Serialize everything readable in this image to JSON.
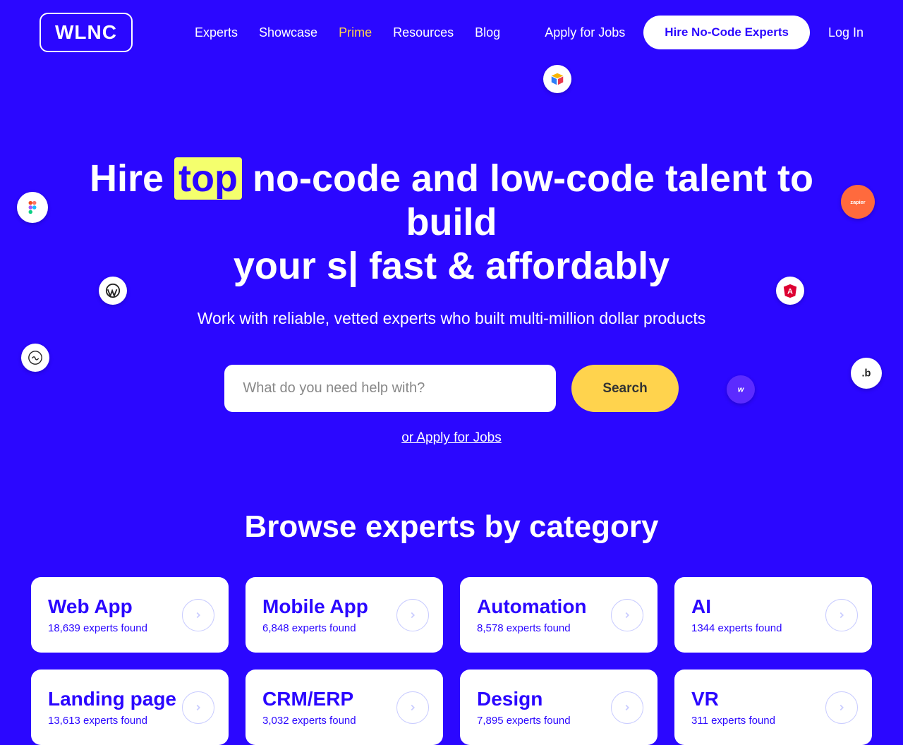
{
  "brand": "WLNC",
  "nav": {
    "experts": "Experts",
    "showcase": "Showcase",
    "prime": "Prime",
    "resources": "Resources",
    "blog": "Blog"
  },
  "header": {
    "apply": "Apply for Jobs",
    "hire": "Hire No-Code Experts",
    "login": "Log In"
  },
  "hero": {
    "line_pre": "Hire",
    "highlight": "top",
    "line_post": "no-code and low-code talent to build",
    "line2_pre": "your s",
    "line2_post": " fast & affordably",
    "subtitle": "Work with reliable, vetted experts who built multi-million dollar products",
    "search_placeholder": "What do you need help with?",
    "search_button": "Search",
    "apply_link": "or Apply for Jobs"
  },
  "badges": {
    "airtable": "airtable-icon",
    "figma": "figma-icon",
    "wordpress": "wordpress-icon",
    "tilda": "tilda-icon",
    "zapier": "zapier-icon",
    "angular": "angular-icon",
    "bubble": "bubble-icon",
    "webflow": "webflow-icon"
  },
  "categories": {
    "heading": "Browse experts by category",
    "items": [
      {
        "title": "Web App",
        "count": "18,639 experts found"
      },
      {
        "title": "Mobile App",
        "count": "6,848 experts found"
      },
      {
        "title": "Automation",
        "count": "8,578 experts found"
      },
      {
        "title": "AI",
        "count": "1344 experts found"
      },
      {
        "title": "Landing page",
        "count": "13,613 experts found"
      },
      {
        "title": "CRM/ERP",
        "count": "3,032 experts found"
      },
      {
        "title": "Design",
        "count": "7,895 experts found"
      },
      {
        "title": "VR",
        "count": "311 experts found"
      }
    ]
  }
}
